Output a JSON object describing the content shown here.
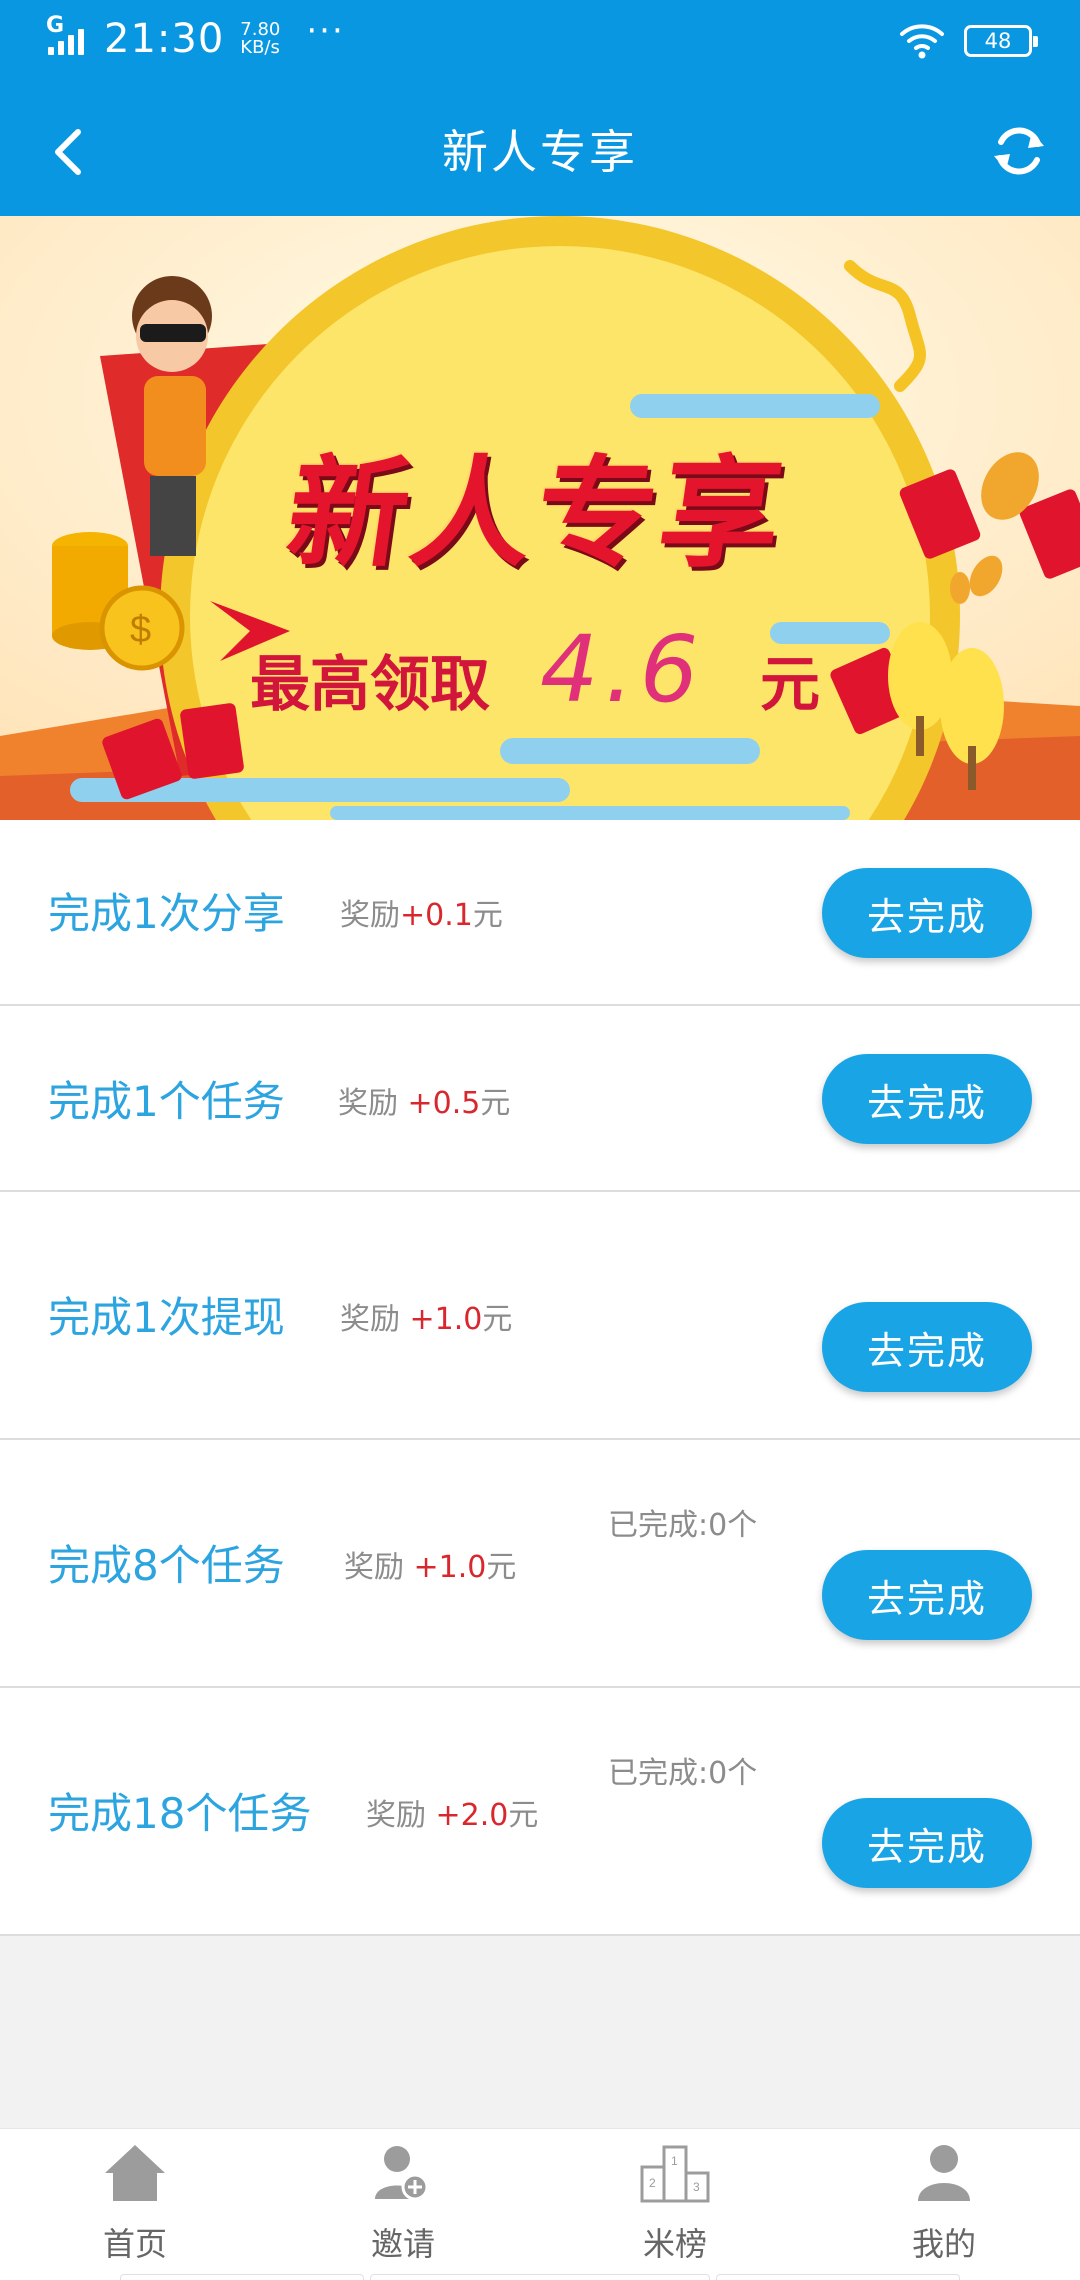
{
  "status_bar": {
    "network": "G",
    "time": "21:30",
    "speed_value": "7.80",
    "speed_unit": "KB/s",
    "more": "···",
    "battery": "48"
  },
  "header": {
    "title": "新人专享",
    "back_icon": "back-chevron-icon",
    "refresh_icon": "refresh-icon"
  },
  "banner": {
    "headline": "新人专享",
    "sub_label": "最高领取",
    "amount": "4.6",
    "unit": "元"
  },
  "tasks": [
    {
      "name": "完成1次分享",
      "reward_label": "奖励",
      "reward_amount": "+0.1",
      "reward_unit": "元",
      "done_text": "",
      "button": "去完成"
    },
    {
      "name": "完成1个任务",
      "reward_label": "奖励 ",
      "reward_amount": "+0.5",
      "reward_unit": "元",
      "done_text": "",
      "button": "去完成"
    },
    {
      "name": "完成1次提现",
      "reward_label": "奖励 ",
      "reward_amount": "+1.0",
      "reward_unit": "元",
      "done_text": "",
      "button": "去完成"
    },
    {
      "name": "完成8个任务",
      "reward_label": "奖励 ",
      "reward_amount": "+1.0",
      "reward_unit": "元",
      "done_text": "已完成:0个",
      "button": "去完成"
    },
    {
      "name": "完成18个任务",
      "reward_label": "奖励 ",
      "reward_amount": "+2.0",
      "reward_unit": "元",
      "done_text": "已完成:0个",
      "button": "去完成"
    }
  ],
  "bottom_nav": [
    {
      "label": "首页",
      "icon": "home-icon"
    },
    {
      "label": "邀请",
      "icon": "invite-user-icon"
    },
    {
      "label": "米榜",
      "icon": "ranking-podium-icon"
    },
    {
      "label": "我的",
      "icon": "profile-icon"
    }
  ],
  "colors": {
    "primary": "#0a97e1",
    "button": "#19a4e6",
    "task_text": "#2ba4e0",
    "reward_amount": "#d9272e"
  }
}
